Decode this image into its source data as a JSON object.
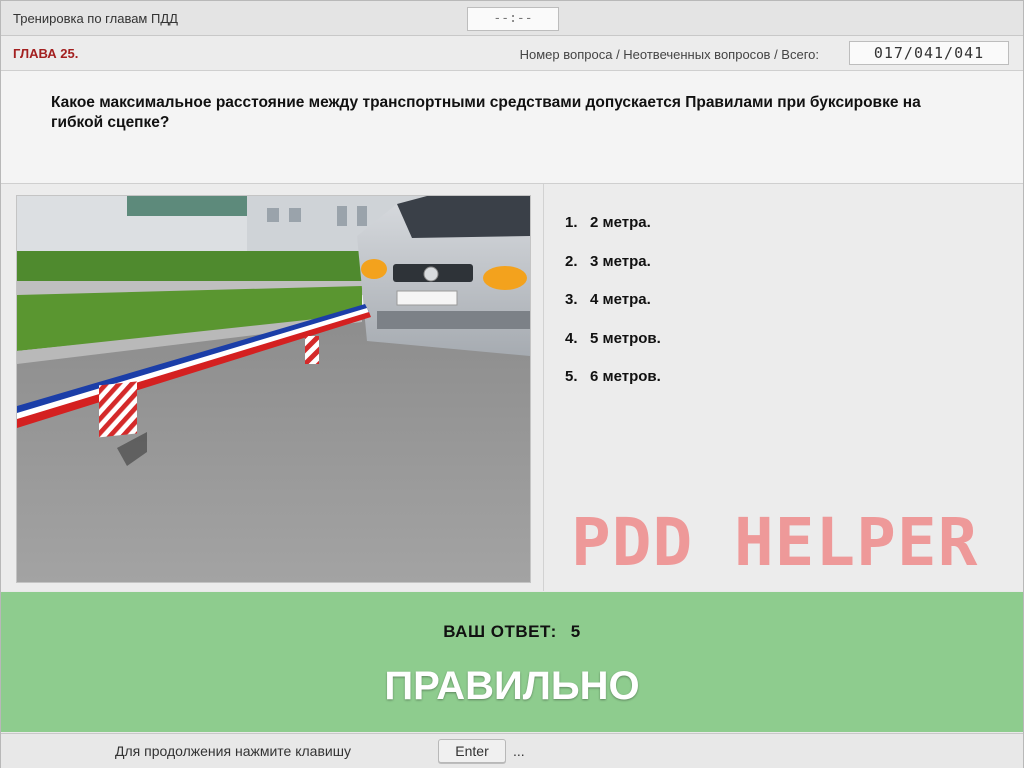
{
  "window": {
    "title": "Тренировка по главам ПДД",
    "timer": "--:--"
  },
  "info": {
    "chapter": "ГЛАВА 25.",
    "counter_label": "Номер вопроса / Неотвеченных вопросов / Всего:",
    "counter_value": "017/041/041"
  },
  "question": {
    "text": "Какое максимальное расстояние между транспортными средствами допускается Правилами при буксировке на гибкой сцепке?"
  },
  "image": {
    "description_icon": "towing-photo"
  },
  "answers": [
    {
      "num": "1.",
      "label": "2 метра."
    },
    {
      "num": "2.",
      "label": "3 метра."
    },
    {
      "num": "3.",
      "label": "4 метра."
    },
    {
      "num": "4.",
      "label": "5 метров."
    },
    {
      "num": "5.",
      "label": "6 метров."
    }
  ],
  "watermark": "PDD HELPER",
  "result": {
    "your_answer_label": "ВАШ ОТВЕТ:",
    "your_answer_value": "5",
    "verdict": "ПРАВИЛЬНО",
    "color": "#8ecc8e"
  },
  "footer": {
    "hint": "Для продолжения нажмите клавишу",
    "key": "Enter",
    "ellipsis": "..."
  }
}
